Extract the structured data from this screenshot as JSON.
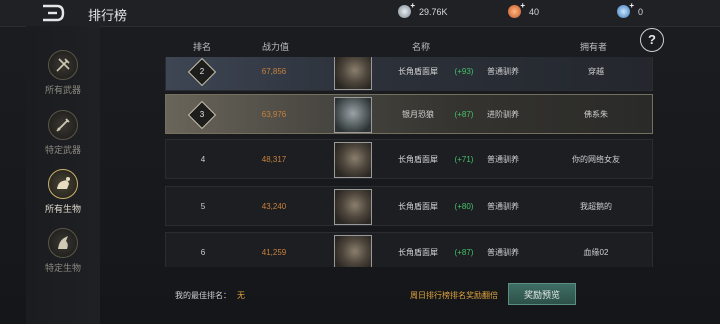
{
  "header": {
    "title": "排行榜",
    "resources": [
      {
        "icon": "silver-coin-icon",
        "value": "29.76K",
        "color": "#b8c0c8"
      },
      {
        "icon": "gold-coin-icon",
        "value": "40",
        "color": "#e0733a"
      },
      {
        "icon": "gem-icon",
        "value": "0",
        "color": "#7ab6e6"
      }
    ]
  },
  "sidebar": {
    "items": [
      {
        "label": "所有武器",
        "icon": "weapons-icon",
        "active": false
      },
      {
        "label": "特定武器",
        "icon": "sword-icon",
        "active": false
      },
      {
        "label": "所有生物",
        "icon": "creatures-icon",
        "active": true
      },
      {
        "label": "特定生物",
        "icon": "dragon-head-icon",
        "active": false
      }
    ]
  },
  "table": {
    "columns": [
      "排名",
      "战力值",
      "名称",
      "拥有者"
    ],
    "rows": [
      {
        "rank": "2",
        "power": "67,856",
        "name": "长角盾面犀",
        "bonus": "(+93)",
        "raise": "普通驯养",
        "owner": "穿越",
        "style": "first"
      },
      {
        "rank": "3",
        "power": "63,976",
        "name": "银月恐狼",
        "bonus": "(+87)",
        "raise": "进阶驯养",
        "owner": "佛系朱",
        "style": "highlight"
      },
      {
        "rank": "4",
        "power": "48,317",
        "name": "长角盾面犀",
        "bonus": "(+71)",
        "raise": "普通驯养",
        "owner": "你的网络女友",
        "style": "normal"
      },
      {
        "rank": "5",
        "power": "43,240",
        "name": "长角盾面犀",
        "bonus": "(+80)",
        "raise": "普通驯养",
        "owner": "我超鹅的",
        "style": "normal"
      },
      {
        "rank": "6",
        "power": "41,259",
        "name": "长角盾面犀",
        "bonus": "(+87)",
        "raise": "普通驯养",
        "owner": "血缘02",
        "style": "normal"
      }
    ]
  },
  "footer": {
    "best_rank_label": "我的最佳排名：",
    "best_rank_value": "无",
    "sunday_note": "周日排行榜排名奖励翻倍",
    "reward_button": "奖励预览"
  },
  "help_label": "?"
}
